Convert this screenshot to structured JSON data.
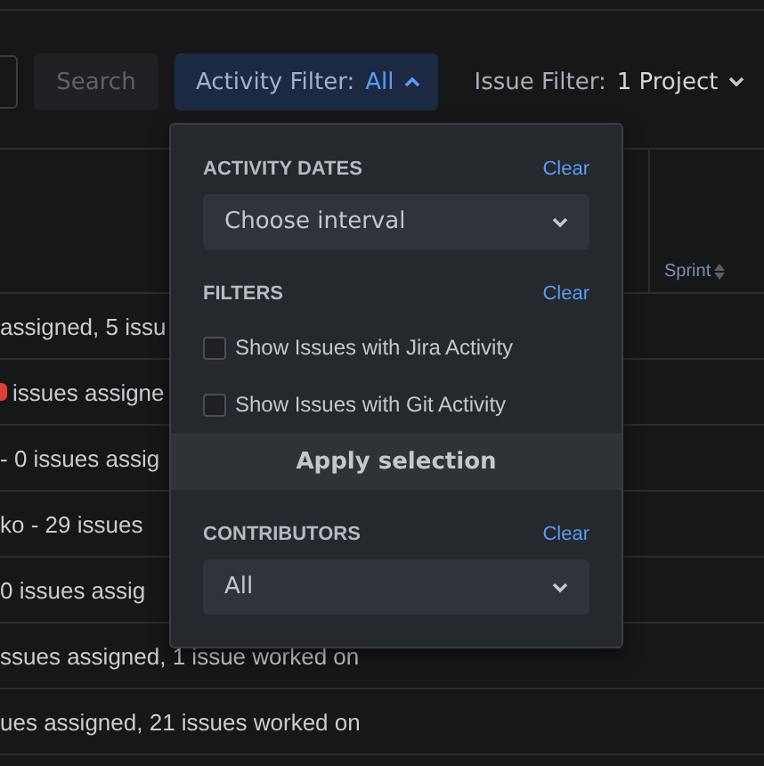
{
  "toolbar": {
    "search_button": "Search",
    "activity_filter": {
      "label": "Activity Filter:",
      "value": "All",
      "expanded": true
    },
    "issue_filter": {
      "label": "Issue Filter:",
      "value": "1 Project"
    }
  },
  "table": {
    "columns": [
      {
        "label": "Sprint"
      }
    ],
    "rows": [
      {
        "text": "assigned, 5 issu",
        "flag": false
      },
      {
        "text": "issues assigne",
        "flag": true
      },
      {
        "text": "- 0 issues assig",
        "flag": false
      },
      {
        "text": "ko - 29 issues",
        "flag": false
      },
      {
        "text": "0 issues assig",
        "flag": false
      },
      {
        "text": "ssues assigned, 1 issue worked on",
        "flag": false
      },
      {
        "text": "ues assigned, 21 issues worked on",
        "flag": false
      }
    ]
  },
  "popup": {
    "sections": [
      {
        "title": "ACTIVITY DATES",
        "clear": "Clear",
        "kind": "select",
        "value": "Choose interval"
      },
      {
        "title": "FILTERS",
        "clear": "Clear",
        "kind": "checks",
        "options": [
          {
            "label": "Show Issues with Jira Activity",
            "checked": false
          },
          {
            "label": "Show Issues with Git Activity",
            "checked": false
          }
        ],
        "apply": "Apply selection"
      },
      {
        "title": "CONTRIBUTORS",
        "clear": "Clear",
        "kind": "select",
        "value": "All"
      }
    ]
  }
}
